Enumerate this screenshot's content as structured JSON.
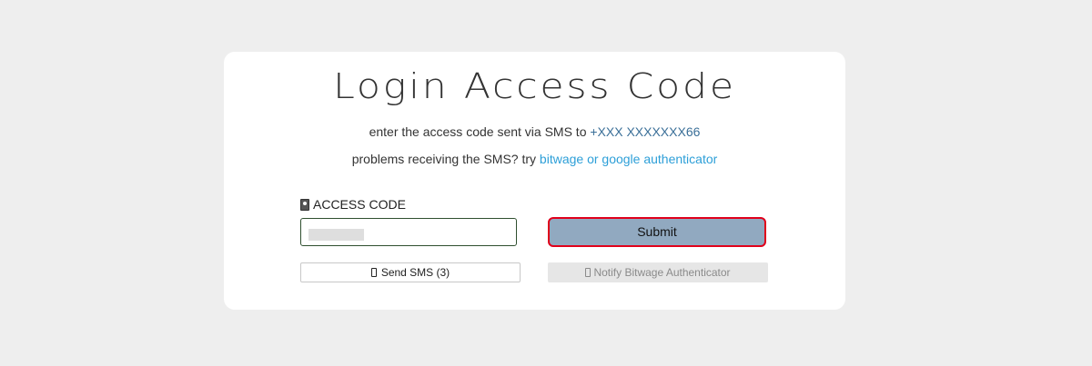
{
  "title": "Login Access Code",
  "instructions": {
    "sent_prefix": "enter the access code sent via SMS to ",
    "phone_number": "+XXX XXXXXXX66",
    "problems_prefix": "problems receiving the SMS? try ",
    "alt_link": "bitwage or google authenticator"
  },
  "form": {
    "code_label": "ACCESS CODE",
    "code_value": "",
    "submit_label": "Submit",
    "send_sms_label": "Send SMS (3)",
    "notify_label": "Notify Bitwage Authenticator"
  },
  "icons": {
    "label_icon": "id-badge-icon",
    "sms_icon": "mobile-phone-icon",
    "notify_icon": "mobile-phone-icon"
  },
  "colors": {
    "page_background": "#eeeeee",
    "card_background": "#ffffff",
    "link": "#2d9fd8",
    "phone": "#3a6f98",
    "submit_background": "#91a9c0",
    "submit_highlight_border": "#e0001b"
  }
}
